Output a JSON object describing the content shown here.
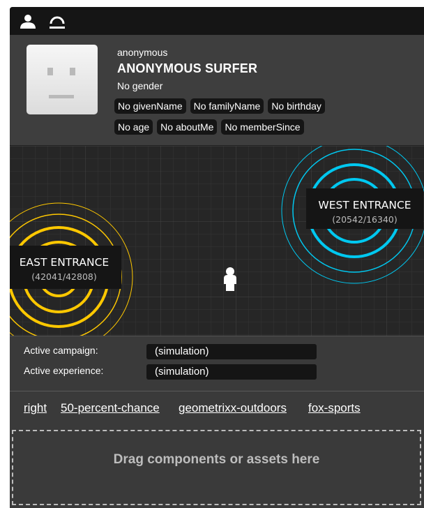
{
  "toolbar": {
    "icons": [
      "user-icon",
      "logout-icon"
    ]
  },
  "profile": {
    "username": "anonymous",
    "display_name": "ANONYMOUS SURFER",
    "gender": "No gender",
    "tags_row1": [
      "No givenName",
      "No familyName",
      "No birthday"
    ],
    "tags_row2": [
      "No age",
      "No aboutMe",
      "No memberSince"
    ]
  },
  "map": {
    "east": {
      "label": "EAST ENTRANCE",
      "coords": "(42041/42808)",
      "color": "#ffc800"
    },
    "west": {
      "label": "WEST ENTRANCE",
      "coords": "(20542/16340)",
      "color": "#00c8f0"
    },
    "person_icon": "person-icon"
  },
  "campaign": {
    "active_campaign_label": "Active campaign:",
    "active_campaign_value": "(simulation)",
    "active_experience_label": "Active experience:",
    "active_experience_value": "(simulation)"
  },
  "segments": [
    "right",
    "50-percent-chance",
    "geometrixx-outdoors",
    "fox-sports"
  ],
  "dropzone": {
    "text": "Drag components or assets here"
  }
}
